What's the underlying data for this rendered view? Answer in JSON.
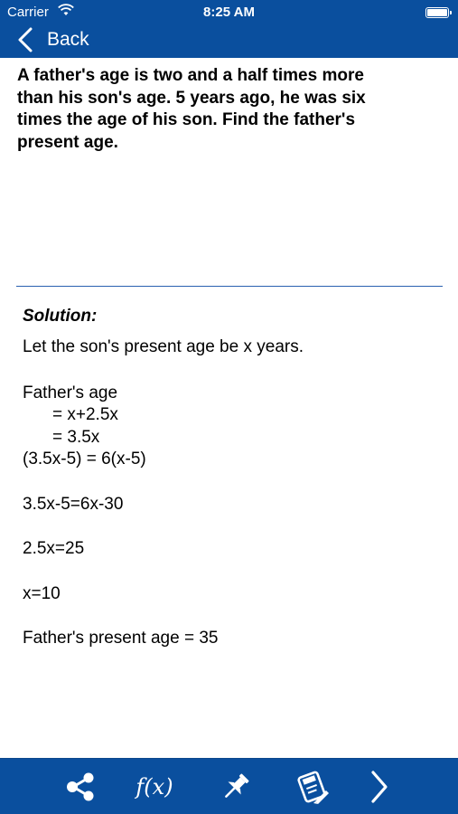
{
  "status_bar": {
    "carrier": "Carrier",
    "time": "8:25 AM"
  },
  "nav": {
    "back_label": "Back"
  },
  "question": {
    "lines": [
      "A father's age is two and a half times more",
      "than his son's age. 5 years ago, he was six",
      "times the age of his son. Find the father's",
      "present age."
    ]
  },
  "solution": {
    "heading": "Solution:",
    "steps": [
      "Let the son's present age be x years.",
      "Father's age",
      "= x+2.5x",
      "= 3.5x",
      "(3.5x-5) = 6(x-5)",
      "3.5x-5=6x-30",
      "2.5x=25",
      "x=10",
      "Father's present age = 35"
    ]
  },
  "toolbar": {
    "formula_label": "f(x)",
    "icons": [
      "share-icon",
      "formula-icon",
      "pin-icon",
      "edit-note-icon",
      "next-icon"
    ]
  },
  "colors": {
    "accent": "#0a4f9e",
    "divider": "#2a60b0"
  }
}
